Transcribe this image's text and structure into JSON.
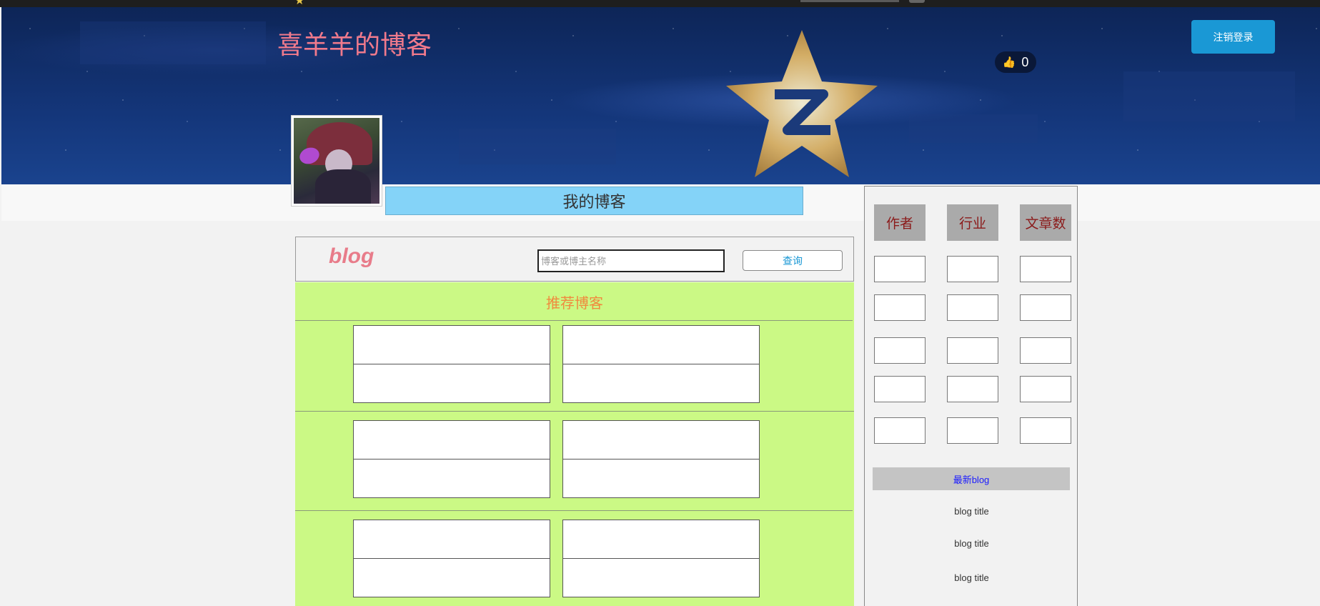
{
  "header": {
    "site_title": "喜羊羊的博客",
    "like_count": "0",
    "logout_label": "注销登录"
  },
  "profile": {
    "my_blog_tab": "我的博客"
  },
  "search": {
    "logo": "blog",
    "placeholder": "博客或博主名称",
    "query_label": "查询"
  },
  "recommend": {
    "title": "推荐博客"
  },
  "sidebar": {
    "columns": [
      "作者",
      "行业",
      "文章数"
    ],
    "latest_label": "最新blog",
    "posts": [
      "blog title",
      "blog title",
      "blog title"
    ]
  },
  "colors": {
    "banner": "#0d2557",
    "site_title": "#f07a8c",
    "logout_button": "#1a98d5",
    "tab": "#84d3f8",
    "recommend_bg": "#cbf985",
    "recommend_title": "#f08a3e",
    "column_head_bg": "#aaaaaa",
    "column_head_text": "#8b1a1a",
    "latest_text": "#1a1aff"
  }
}
